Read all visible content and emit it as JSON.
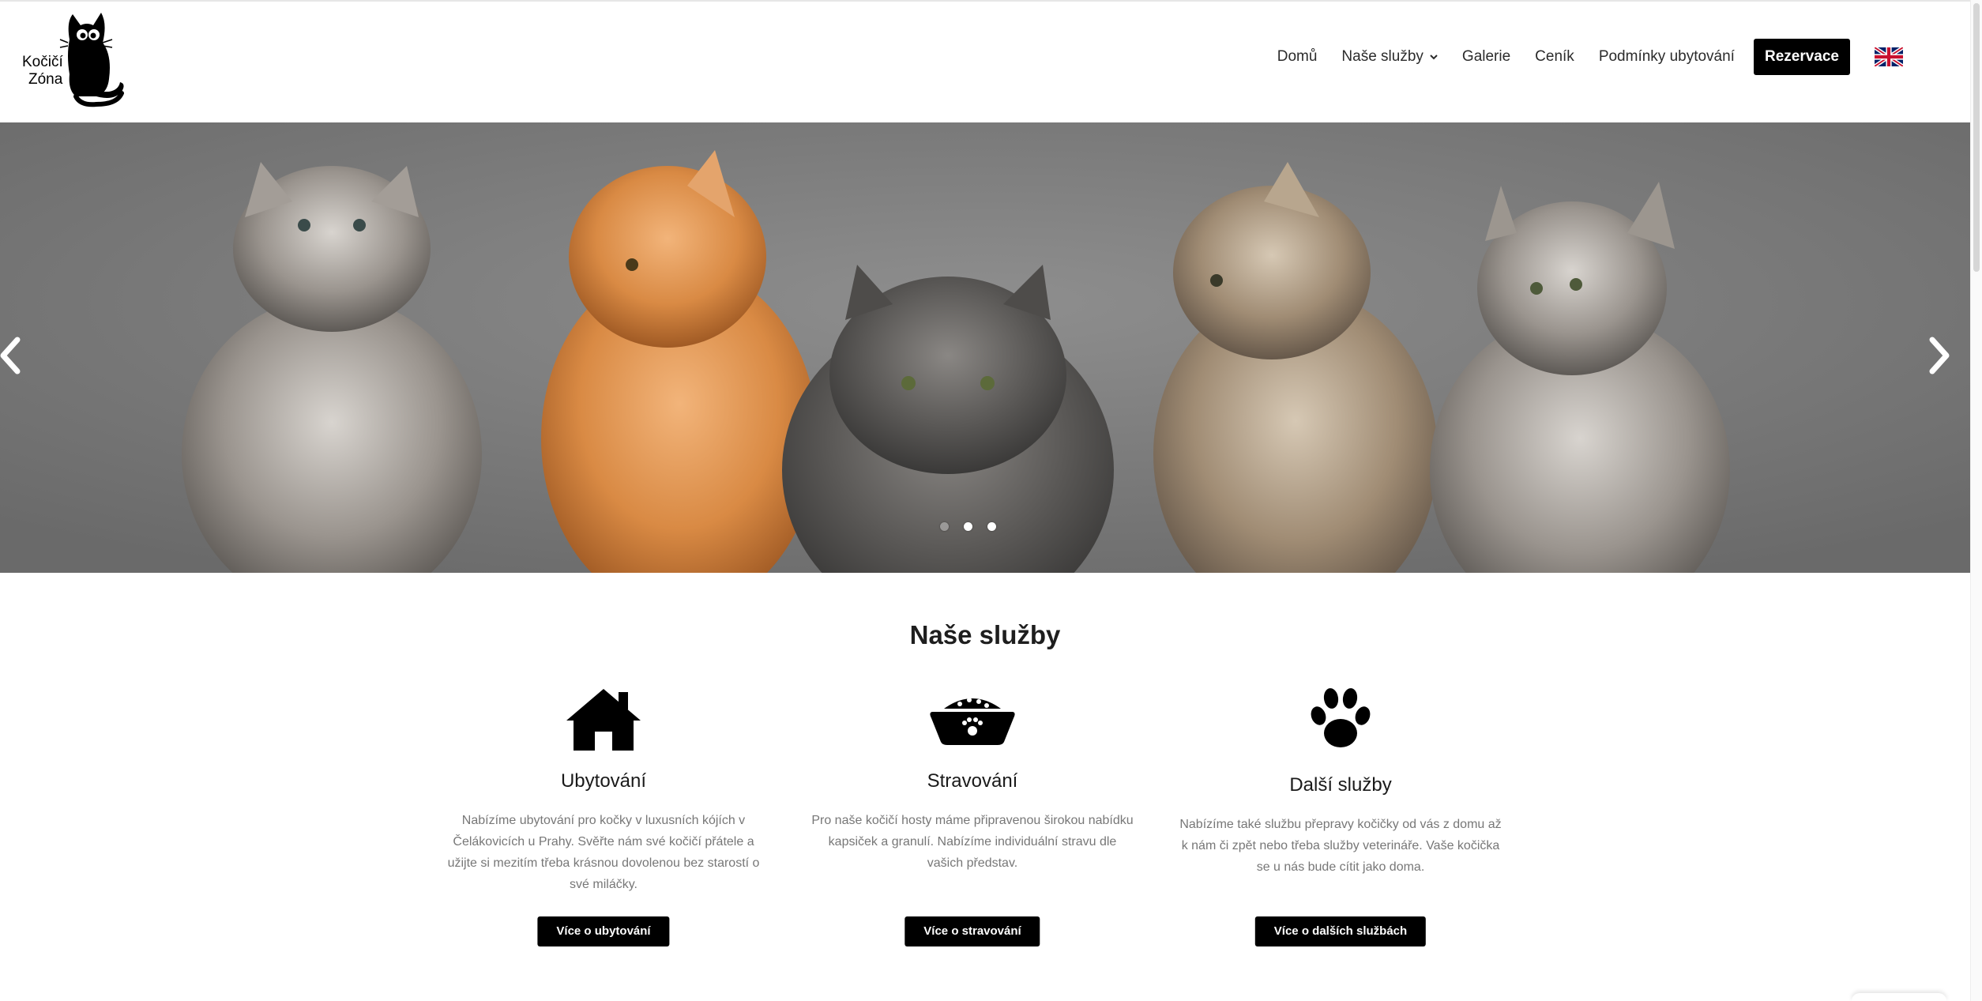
{
  "brand": {
    "logo_text_line1": "Kočičí",
    "logo_text_line2": "Zóna"
  },
  "nav": {
    "items": [
      {
        "label": "Domů"
      },
      {
        "label": "Naše služby",
        "has_dropdown": true
      },
      {
        "label": "Galerie"
      },
      {
        "label": "Ceník"
      },
      {
        "label": "Podmínky ubytování"
      }
    ],
    "cta_label": "Rezervace",
    "language_icon": "uk-flag-icon"
  },
  "hero": {
    "slide_count": 3,
    "active_slide": 1,
    "prev_icon": "chevron-left-icon",
    "next_icon": "chevron-right-icon"
  },
  "services": {
    "title": "Naše služby",
    "items": [
      {
        "icon": "house-icon",
        "title": "Ubytování",
        "text": "Nabízíme ubytování pro kočky v luxusních kójích v Čelákovicích u Prahy. Svěřte nám své kočičí přátele a užijte si mezitím třeba krásnou dovolenou bez starostí o své miláčky.",
        "button": "Více o ubytování"
      },
      {
        "icon": "food-bowl-icon",
        "title": "Stravování",
        "text": "Pro naše kočičí hosty máme připravenou širokou nabídku kapsiček a granulí. Nabízíme individuální stravu dle vašich představ.",
        "button": "Více o stravování"
      },
      {
        "icon": "paw-icon",
        "title": "Další služby",
        "text": "Nabízíme také službu přepravy kočičky od vás z domu až k nám či zpět nebo třeba služby veterináře. Vaše kočička se u nás bude cítit jako doma.",
        "button": "Více o dalších službách"
      }
    ]
  },
  "colors": {
    "accent": "#000000",
    "text_muted": "#777777",
    "hero_bg": "#7a7a7a"
  }
}
